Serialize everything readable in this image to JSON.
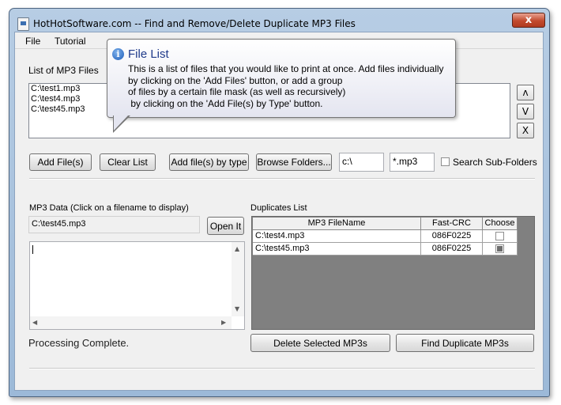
{
  "window": {
    "title": "HotHotSoftware.com -- Find and Remove/Delete Duplicate MP3 Files",
    "close_label": "x"
  },
  "menu": {
    "items": [
      "File",
      "Tutorial"
    ]
  },
  "mp3_files": {
    "label": "List of MP3 Files",
    "items": [
      "C:\\test1.mp3",
      "C:\\test4.mp3",
      "C:\\test45.mp3"
    ],
    "move_up_label": "ʌ",
    "move_down_label": "V",
    "remove_label": "X"
  },
  "tooltip": {
    "title": "File List",
    "lines": [
      "This is a list of files that you would like to print at once. Add files individually",
      "by clicking on the 'Add Files' button, or add a group",
      "of files by a certain file mask (as well as recursively)",
      " by clicking on the 'Add File(s) by Type' button."
    ]
  },
  "toolbar": {
    "add_files": "Add File(s)",
    "clear_list": "Clear List",
    "add_by_type": "Add file(s) by type",
    "browse_folders": "Browse Folders...",
    "folder_value": "c:\\",
    "mask_value": "*.mp3",
    "search_subfolders": "Search Sub-Folders"
  },
  "mp3_data": {
    "label": "MP3 Data (Click on a filename to display)",
    "selected_file": "C:\\test45.mp3",
    "open_button": "Open It"
  },
  "duplicates": {
    "label": "Duplicates List",
    "headers": [
      "MP3 FileName",
      "Fast-CRC",
      "Choose"
    ],
    "rows": [
      {
        "file": "C:\\test4.mp3",
        "crc": "086F0225",
        "chosen": false
      },
      {
        "file": "C:\\test45.mp3",
        "crc": "086F0225",
        "chosen": true
      }
    ]
  },
  "status": {
    "text": "Processing Complete."
  },
  "actions": {
    "delete_selected": "Delete Selected MP3s",
    "find_duplicates": "Find Duplicate MP3s"
  }
}
